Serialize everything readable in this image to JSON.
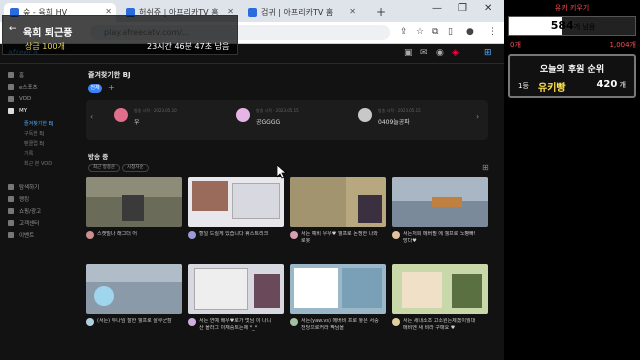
{
  "browser": {
    "tabs": [
      {
        "label": "숲 - 육희 HV",
        "favicon": "#2a6be0"
      },
      {
        "label": "허쉬쥬 | 아프리카TV 홈",
        "favicon": "#2a6be0"
      },
      {
        "label": "검귀 | 아프리카TV 홈",
        "favicon": "#2a6be0"
      }
    ],
    "url": "play.afreecatv.com/...",
    "new_tab_glyph": "+",
    "minimize_glyph": "—",
    "restore_glyph": "❐",
    "close_glyph": "✕"
  },
  "overlay": {
    "title": "육희 퇴근풍",
    "label": "상금",
    "amount": "100개",
    "time": "23시간 46분 47초 남음",
    "back_glyph": "←"
  },
  "site": {
    "brand": "afreeca"
  },
  "sidebar": {
    "items": [
      {
        "label": "홈",
        "active": false
      },
      {
        "label": "e스포츠",
        "active": false
      },
      {
        "label": "VOD",
        "active": false
      },
      {
        "label": "MY",
        "active": true
      }
    ],
    "subitems": [
      {
        "label": "즐겨찾기한 BJ",
        "active": true
      },
      {
        "label": "구독한 BJ",
        "active": false
      },
      {
        "label": "팬클럽 BJ",
        "active": false
      },
      {
        "label": "기록",
        "active": false
      },
      {
        "label": "최근 본 VOD",
        "active": false
      }
    ],
    "items2": [
      {
        "label": "탐색하기"
      },
      {
        "label": "랭킹"
      },
      {
        "label": "쇼핑/광고"
      },
      {
        "label": "고객센터"
      },
      {
        "label": "이벤트"
      }
    ]
  },
  "main": {
    "section_title": "즐겨찾기한 BJ",
    "chip": "전체",
    "favorites": [
      {
        "meta": "방송 시작 · 2023.05.10",
        "name": "우",
        "avatar": "#e06f8b"
      },
      {
        "meta": "방송 시작 · 2023.05.15",
        "name": "공GGGG",
        "avatar": "#e6b5e6"
      },
      {
        "meta": "방송 시작 · 2023.05.15",
        "name": "0409늘공파",
        "avatar": "#c8c8c8"
      }
    ],
    "live_title": "방송 중",
    "filters": [
      "최근 방송순",
      "시청자순"
    ],
    "streams": [
      {
        "title": "스캣빌나 래그더 어",
        "title2": "",
        "avatar": "#cc8f8f"
      },
      {
        "title": "할일 드릴게 있습니다 휴스트리크",
        "title2": "",
        "avatar": "#9a9ad6"
      },
      {
        "title": "서든 예비 우우♥ 웰프로 논쟁한 나와",
        "title2": "로봇",
        "avatar": "#d6a0b0"
      },
      {
        "title": "서든저희 메버필 에 웰프로 노빵빠!",
        "title2": "망다♥",
        "avatar": "#e0c0a0"
      },
      {
        "title": "(서든) 투나임 잘한 웰프로 살루군잠",
        "title2": "",
        "avatar": "#b0d0e0"
      },
      {
        "title": "서든 연예 배우♥로가 멋님 이 나니 ",
        "title2": "산 올라그 이재중트는제 *_*",
        "avatar": "#d0b0e0"
      },
      {
        "title": "서든(yaw.vs) 메버비 프로 놓은 서중",
        "title2": "천당으로커라 짝님을",
        "avatar": "#a0c0a0"
      },
      {
        "title": "서든 세내소조 고소원는제겠이뭘대",
        "title2": "메비엔 새 비라 구매요 ♥",
        "avatar": "#e0d0a0"
      }
    ]
  },
  "goal_panel": {
    "title": "유키 키우기",
    "count": "584",
    "count_unit": "개 남음",
    "min": "0개",
    "max": "1,004개",
    "progress": 0.42,
    "ranking_title": "오늘의 후원 순위",
    "rank": "1등",
    "name": "유키빵",
    "value": "420",
    "value_unit": " 개"
  },
  "colors": {
    "accent": "#3b82f6",
    "goal_red": "#ff4d4d",
    "rank_gold": "#ffe14d"
  }
}
